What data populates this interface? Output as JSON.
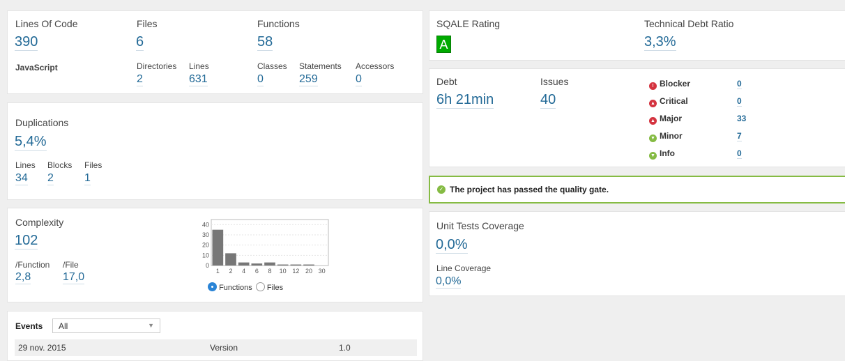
{
  "size": {
    "lines_of_code_label": "Lines Of Code",
    "lines_of_code": "390",
    "language": "JavaScript",
    "files_label": "Files",
    "files": "6",
    "directories_label": "Directories",
    "directories": "2",
    "lines_label": "Lines",
    "lines": "631",
    "functions_label": "Functions",
    "functions": "58",
    "classes_label": "Classes",
    "classes": "0",
    "statements_label": "Statements",
    "statements": "259",
    "accessors_label": "Accessors",
    "accessors": "0"
  },
  "duplications": {
    "title": "Duplications",
    "value": "5,4%",
    "lines_label": "Lines",
    "lines": "34",
    "blocks_label": "Blocks",
    "blocks": "2",
    "files_label": "Files",
    "files": "1"
  },
  "complexity": {
    "title": "Complexity",
    "value": "102",
    "per_function_label": "/Function",
    "per_function": "2,8",
    "per_file_label": "/File",
    "per_file": "17,0",
    "radio_functions": "Functions",
    "radio_files": "Files",
    "selected": "Functions"
  },
  "chart_data": {
    "type": "bar",
    "categories": [
      "1",
      "2",
      "4",
      "6",
      "8",
      "10",
      "12",
      "20",
      "30"
    ],
    "values": [
      35,
      12,
      3,
      2,
      3,
      1,
      1,
      1,
      0
    ],
    "yticks": [
      "40",
      "30",
      "20",
      "10",
      "0"
    ],
    "ylim": [
      0,
      45
    ],
    "bar_color": "#777777"
  },
  "events": {
    "label": "Events",
    "filter_value": "All",
    "rows": [
      {
        "date": "29 nov. 2015",
        "type": "Version",
        "value": "1.0"
      }
    ]
  },
  "sqale": {
    "rating_label": "SQALE Rating",
    "rating": "A",
    "debt_ratio_label": "Technical Debt Ratio",
    "debt_ratio": "3,3%",
    "rating_color": "#00aa00"
  },
  "debt": {
    "debt_label": "Debt",
    "debt": "6h 21min",
    "issues_label": "Issues",
    "issues": "40",
    "severities": [
      {
        "label": "Blocker",
        "count": "0",
        "icon": "blocker-icon",
        "color": "#d4333f"
      },
      {
        "label": "Critical",
        "count": "0",
        "icon": "critical-icon",
        "color": "#d4333f"
      },
      {
        "label": "Major",
        "count": "33",
        "icon": "major-icon",
        "color": "#d4333f"
      },
      {
        "label": "Minor",
        "count": "7",
        "icon": "minor-icon",
        "color": "#85bb43"
      },
      {
        "label": "Info",
        "count": "0",
        "icon": "info-icon",
        "color": "#85bb43"
      }
    ]
  },
  "quality_gate": {
    "message": "The project has passed the quality gate.",
    "color": "#85bb43"
  },
  "coverage": {
    "title": "Unit Tests Coverage",
    "value": "0,0%",
    "line_coverage_label": "Line Coverage",
    "line_coverage": "0,0%"
  }
}
